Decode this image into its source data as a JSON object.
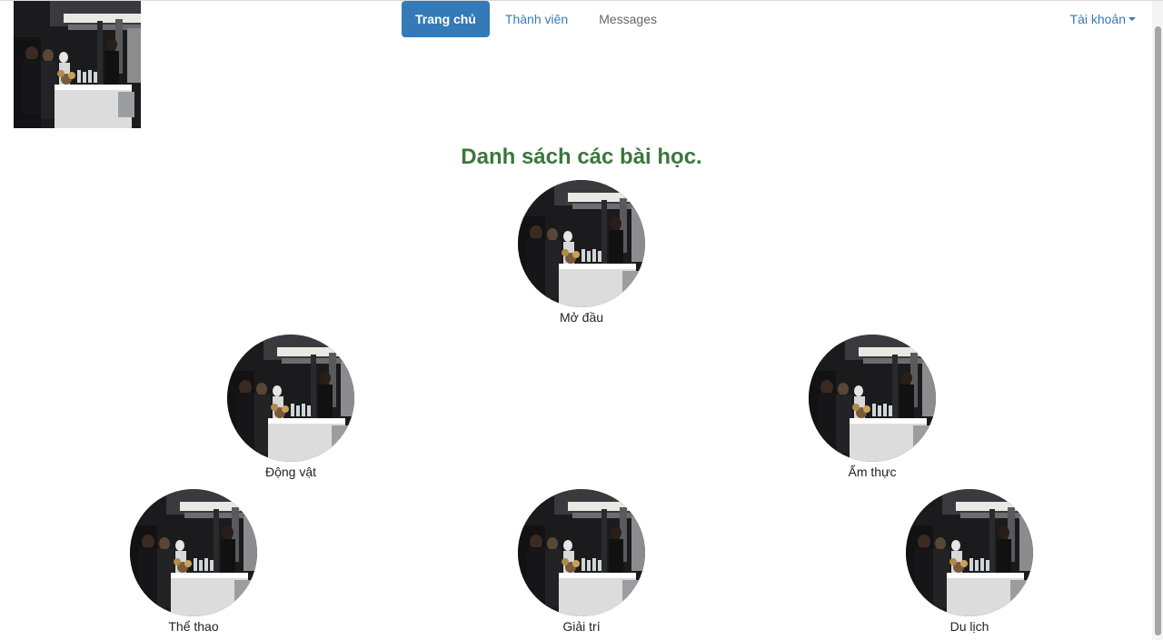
{
  "nav": {
    "items": [
      {
        "label": "Trang chủ",
        "active": true
      },
      {
        "label": "Thành viên",
        "active": false
      },
      {
        "label": "Messages",
        "active": false
      }
    ],
    "account_label": "Tài khoản"
  },
  "heading": "Danh sách các bài học.",
  "lessons": [
    {
      "label": "Mở đầu"
    },
    {
      "label": "Động vật"
    },
    {
      "label": "Ẩm thực"
    },
    {
      "label": "Thể thao"
    },
    {
      "label": "Giải trí"
    },
    {
      "label": "Du lịch"
    }
  ],
  "colors": {
    "accent": "#337ab7",
    "heading": "#3c763d"
  }
}
